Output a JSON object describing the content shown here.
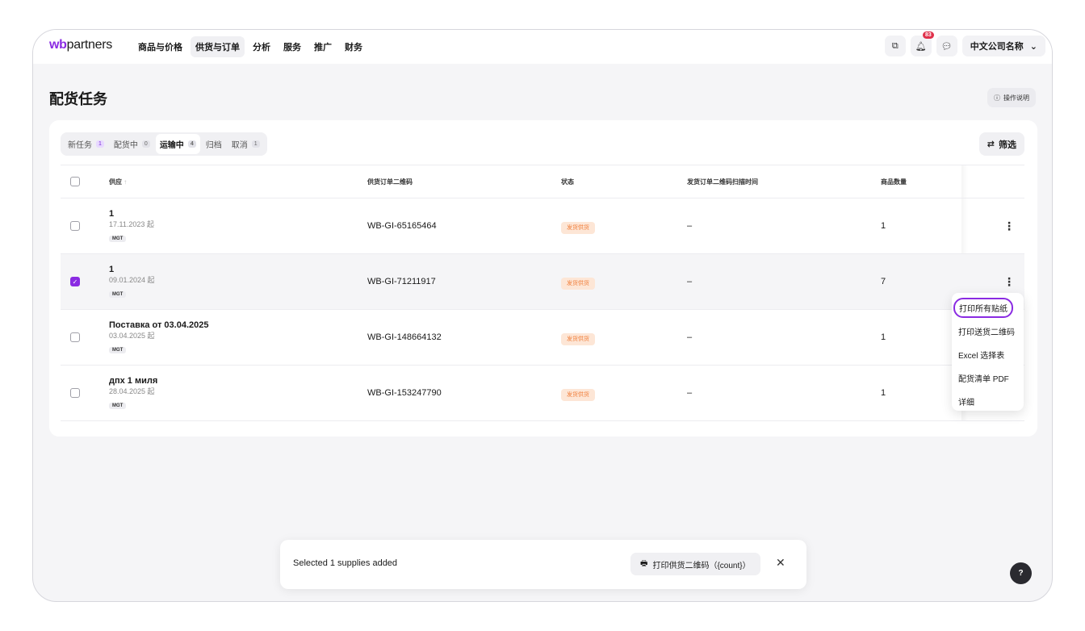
{
  "brand": {
    "logo_wb": "wb",
    "logo_rest": "partners"
  },
  "nav": [
    "商品与价格",
    "供货与订单",
    "分析",
    "服务",
    "推广",
    "财务"
  ],
  "topbar": {
    "notif_badge": "83",
    "company_name": "中文公司名称"
  },
  "page": {
    "title": "配货任务",
    "help_label": "操作说明"
  },
  "tabs": [
    {
      "label": "新任务",
      "count": "1"
    },
    {
      "label": "配货中",
      "count": "0"
    },
    {
      "label": "运输中",
      "count": "4"
    },
    {
      "label": "归档",
      "count": ""
    },
    {
      "label": "取消",
      "count": "1"
    }
  ],
  "filter_label": "筛选",
  "table": {
    "headers": {
      "supply": "供应",
      "qr": "供货订单二维码",
      "status": "状态",
      "scan_time": "发货订单二维码扫描时间",
      "qty": "商品数量"
    },
    "rows": [
      {
        "name": "1",
        "date": "17.11.2023 起",
        "tag": "MGT",
        "qr": "WB-GI-65165464",
        "status": "发货供货",
        "time": "–",
        "qty": "1",
        "checked": false
      },
      {
        "name": "1",
        "date": "09.01.2024 起",
        "tag": "MGT",
        "qr": "WB-GI-71211917",
        "status": "发货供货",
        "time": "–",
        "qty": "7",
        "checked": true
      },
      {
        "name": "Поставка от 03.04.2025",
        "date": "03.04.2025 起",
        "tag": "MGT",
        "qr": "WB-GI-148664132",
        "status": "发货供货",
        "time": "–",
        "qty": "1",
        "checked": false
      },
      {
        "name": "дпх 1 миля",
        "date": "28.04.2025 起",
        "tag": "MGT",
        "qr": "WB-GI-153247790",
        "status": "发货供货",
        "time": "–",
        "qty": "1",
        "checked": false
      }
    ]
  },
  "row_menu": [
    "打印所有贴纸",
    "打印送货二维码",
    "Excel 选择表",
    "配货清单 PDF",
    "详细"
  ],
  "toast": {
    "message": "Selected 1 supplies added",
    "action": "打印供货二维码（{count}）"
  },
  "help_fab": "?"
}
